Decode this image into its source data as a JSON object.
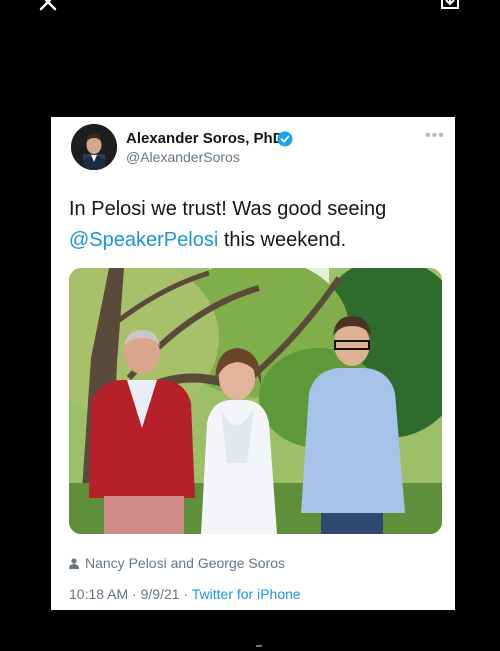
{
  "author": {
    "name": "Alexander Soros, PhD",
    "handle": "@AlexanderSoros"
  },
  "tweet": {
    "text_before": "In Pelosi we trust! Was good seeing ",
    "mention": "@SpeakerPelosi",
    "text_after": " this weekend."
  },
  "tagged": "Nancy Pelosi and George Soros",
  "meta": {
    "time": "10:18 AM",
    "sep1": " · ",
    "date": "9/9/21",
    "sep2": " · ",
    "source": "Twitter for iPhone"
  },
  "icons": {
    "close": "close-icon",
    "share": "share-icon",
    "verified": "verified-badge-icon",
    "more": "more-options-icon",
    "tag": "person-icon"
  },
  "colors": {
    "link": "#1b95e0",
    "verified": "#1da1f2",
    "muted": "#657786",
    "text": "#14171a"
  }
}
